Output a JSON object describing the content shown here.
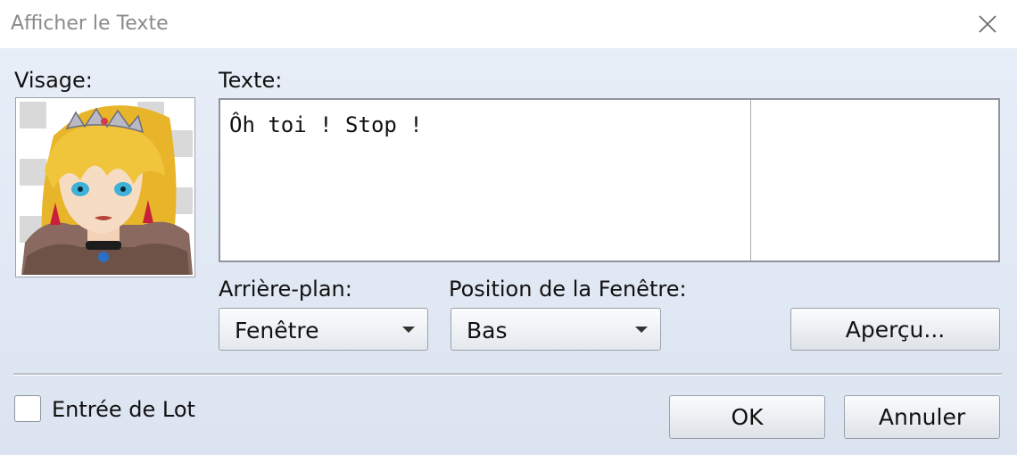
{
  "window": {
    "title": "Afficher le Texte",
    "close_icon": "close-icon"
  },
  "face": {
    "label": "Visage:",
    "icon": "character-portrait"
  },
  "text": {
    "label": "Texte:",
    "value": "Ôh toi ! Stop !"
  },
  "background": {
    "label": "Arrière-plan:",
    "selected": "Fenêtre"
  },
  "position": {
    "label": "Position de la Fenêtre:",
    "selected": "Bas"
  },
  "preview": {
    "label": "Aperçu..."
  },
  "batch": {
    "label": "Entrée de Lot",
    "checked": false
  },
  "buttons": {
    "ok": "OK",
    "cancel": "Annuler"
  },
  "colors": {
    "dialog_bg": "#dbe4f0",
    "border": "#8e959d",
    "title_text": "#8a8a8a"
  }
}
